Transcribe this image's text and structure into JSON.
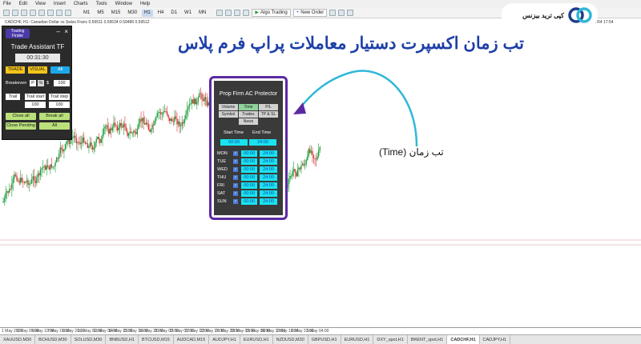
{
  "menu": [
    "File",
    "Edit",
    "View",
    "Insert",
    "Charts",
    "Tools",
    "Window",
    "Help"
  ],
  "toolbar": {
    "timeframes": [
      "M1",
      "M5",
      "M15",
      "M30",
      "H1",
      "H4",
      "D1",
      "W1",
      "MN"
    ],
    "active_timeframe": "H1",
    "algo_label": "Algo Trading",
    "order_label": "New Order"
  },
  "chart": {
    "title": "CADCHF, H1: Canadian Dollar vs Swiss Franc  0.59511 0.59534 0.59486 0.59512",
    "top_right": "20 May 17 H1  MOS R4 17:54",
    "x_ticks": [
      "1 May 2025",
      "5 May 05:00",
      "6 May 10:00",
      "7 May 15:00",
      "8 May 20:00",
      "12 May 01:00",
      "13 May 06:00",
      "14 May 11:00",
      "15 May 16:00",
      "16 May 21:00",
      "20 May 02:00",
      "21 May 07:00",
      "22 May 12:00",
      "23 May 17:00",
      "26 May 22:00",
      "28 May 03:00",
      "29 May 08:00",
      "30 May 13:00",
      "2 May 18:00",
      "3 May 23:00",
      "5 May 04:00"
    ]
  },
  "symbol_tabs": [
    "XAUUSD,M30",
    "BCHUSD,M30",
    "SOLUSD,M30",
    "BNBUSD,H1",
    "BTCUSD,M15",
    "AUDCAD,M15",
    "AUDJPY,H1",
    "EURUSD,H1",
    "NZDUSD,M30",
    "GBPUSD,H1",
    "EURUSD,H1",
    "DXY_spot,H1",
    "BRENT_spot,H1",
    "CADCHF,H1",
    "CADJPY,H1"
  ],
  "active_symbol_tab": "CADCHF,H1",
  "trading_assistant": {
    "logo": "Trading Finder",
    "title": "Trade Assistant TF",
    "time": "00:31:30",
    "buttons": {
      "trade": "TRADE",
      "visual": "VISUAL",
      "all": "All"
    },
    "breakeven_label": "Breakeven",
    "breakeven_p": "P",
    "breakeven_pct": "%",
    "breakeven_dollar": "$",
    "breakeven_value": "100",
    "trail_label": "Trail",
    "trail_start_label": "Trail start",
    "trail_step_label": "Trail step",
    "trail_start_value": "100",
    "trail_step_value": "100",
    "close_all": "Close all",
    "break_all": "Break all",
    "close_pending": "Close Pending",
    "all_pending": "All"
  },
  "prop_firm": {
    "title": "Prop Firm AC Protector",
    "tabs": [
      "Volume",
      "Time",
      "P/L",
      "Symbol",
      "Trades",
      "TP & SL",
      "News"
    ],
    "active_tab": "Time",
    "start_time_label": "Start Time",
    "end_time_label": "End Time",
    "start_default": "00:00",
    "end_default": "24:00",
    "days": [
      {
        "day": "MON",
        "start": "00:00",
        "end": "24:00"
      },
      {
        "day": "TUE",
        "start": "00:00",
        "end": "24:00"
      },
      {
        "day": "WED",
        "start": "00:00",
        "end": "24:00"
      },
      {
        "day": "THU",
        "start": "00:00",
        "end": "24:00"
      },
      {
        "day": "FRI",
        "start": "00:00",
        "end": "24:00"
      },
      {
        "day": "SAT",
        "start": "00:00",
        "end": "24:00"
      },
      {
        "day": "SUN",
        "start": "00:00",
        "end": "24:00"
      }
    ],
    "check_mark": "✓"
  },
  "overlay": {
    "headline": "تب زمان اکسپرت دستیار معاملات پراپ فرم پلاس",
    "caption": "تب زمان (Time)",
    "brand": "کپی ترید بیزنس"
  },
  "colors": {
    "accent": "#5b2aa3",
    "arrow": "#2fb8d8",
    "headline": "#1d3fa8",
    "cyan": "#19e3ef"
  }
}
